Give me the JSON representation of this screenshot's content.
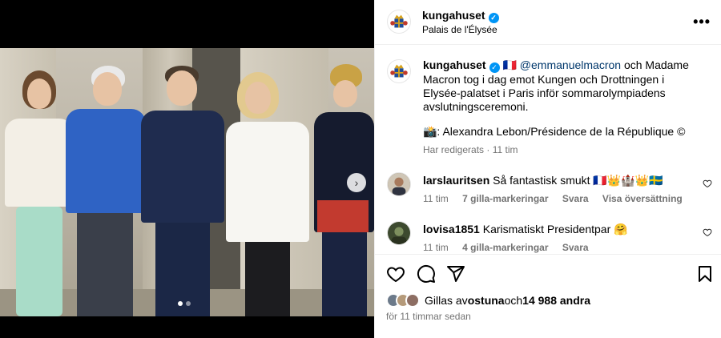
{
  "post": {
    "username": "kungahuset",
    "location": "Palais de l'Élysée",
    "more_icon": "more-horizontal-icon"
  },
  "caption": {
    "username": "kungahuset",
    "flag": "🇫🇷",
    "mention": "@emmanuelmacron",
    "text": " och Madame Macron tog i dag emot Kungen och Drottningen i Elysée-palatset i Paris inför sommarolympiadens avslutningsceremoni.",
    "credit": "📸: Alexandra Lebon/Présidence de la République ©",
    "edited": "Har redigerats",
    "age": "11 tim"
  },
  "comments": [
    {
      "username": "larslauritsen",
      "text": "Så fantastisk smukt 🇫🇷👑🏰👑🇸🇪",
      "age": "11 tim",
      "likes": "7 gilla-markeringar",
      "reply": "Svara",
      "translate": "Visa översättning",
      "avatar_color": "#8a7d6b"
    },
    {
      "username": "lovisa1851",
      "text": "Karismatiskt Presidentpar 🤗",
      "age": "11 tim",
      "likes": "4 gilla-markeringar",
      "reply": "Svara",
      "avatar_color": "#4b5a3a"
    }
  ],
  "likes": {
    "prefix": "Gillas av ",
    "first_user": "ostuna",
    "middle": " och ",
    "count": "14 988 andra"
  },
  "time": "för 11 timmar sedan",
  "carousel": {
    "arrow_icon": "chevron-right-icon",
    "total": 2,
    "current": 1
  },
  "colors": {
    "link": "#00376b",
    "verified": "#0095f6",
    "muted": "#737373"
  }
}
